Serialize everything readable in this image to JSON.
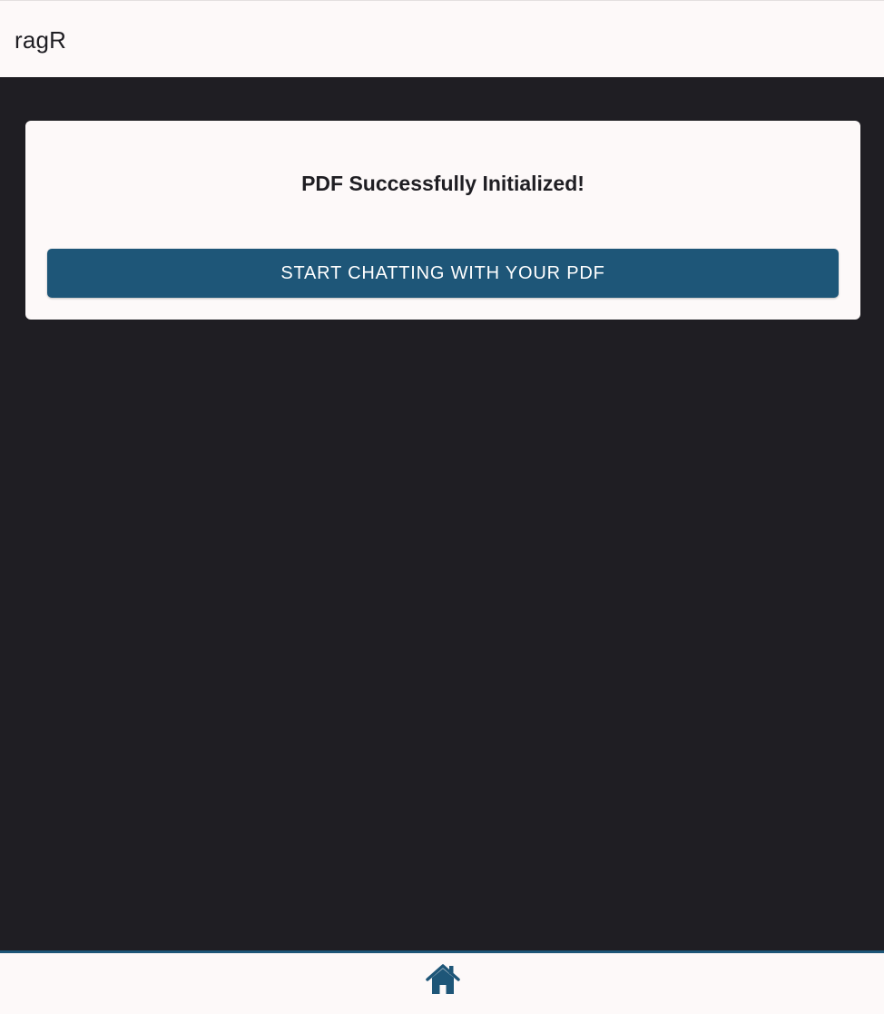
{
  "header": {
    "title": "ragR"
  },
  "card": {
    "title": "PDF Successfully Initialized!",
    "button_label": "START CHATTING WITH YOUR PDF"
  },
  "bottom_nav": {
    "items": [
      {
        "icon": "home-icon"
      }
    ]
  },
  "colors": {
    "background": "#1f1e23",
    "surface": "#fdf9f9",
    "accent": "#1e5678"
  }
}
